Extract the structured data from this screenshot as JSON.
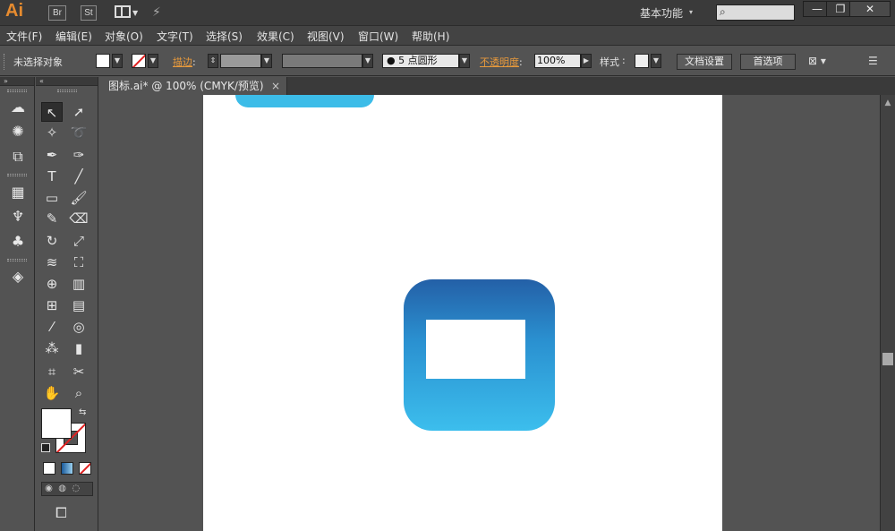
{
  "app": {
    "logo": "Ai",
    "buttons": [
      "Br",
      "St"
    ],
    "workspace": "基本功能",
    "window_controls": [
      "—",
      "❐",
      "✕"
    ]
  },
  "menu": [
    "文件(F)",
    "编辑(E)",
    "对象(O)",
    "文字(T)",
    "选择(S)",
    "效果(C)",
    "视图(V)",
    "窗口(W)",
    "帮助(H)"
  ],
  "control": {
    "selection_status": "未选择对象",
    "stroke_label": "描边",
    "brush_label": "5 点圆形",
    "opacity_label": "不透明度",
    "opacity_value": "100%",
    "style_label": "样式",
    "doc_setup_button": "文档设置",
    "preferences_button": "首选项"
  },
  "document": {
    "tab_title": "图标.ai* @ 100% (CMYK/预览)",
    "close_glyph": "×"
  },
  "colors": {
    "icon_gradient_top": "#2460a7",
    "icon_gradient_bottom": "#3cbeed",
    "accent": "#e68b2f"
  }
}
